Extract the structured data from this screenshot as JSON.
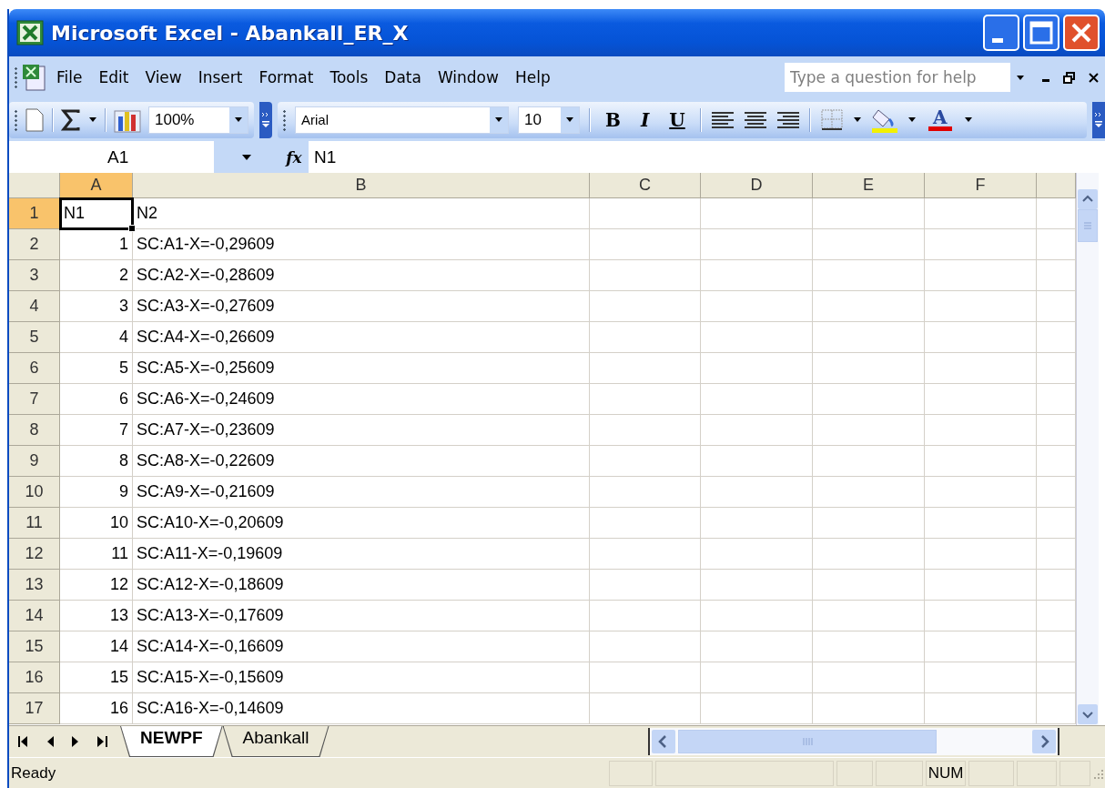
{
  "window": {
    "title": "Microsoft Excel - Abankall_ER_X"
  },
  "menu": [
    {
      "label": "File"
    },
    {
      "label": "Edit"
    },
    {
      "label": "View"
    },
    {
      "label": "Insert"
    },
    {
      "label": "Format"
    },
    {
      "label": "Tools"
    },
    {
      "label": "Data"
    },
    {
      "label": "Window"
    },
    {
      "label": "Help"
    }
  ],
  "help_box": {
    "placeholder": "Type a question for help"
  },
  "toolbar": {
    "zoom": "100%",
    "font": "Arial",
    "font_size": "10",
    "format_buttons": [
      "B",
      "I",
      "U"
    ],
    "font_color_label": "A"
  },
  "formula_bar": {
    "name_box": "A1",
    "function_label": "fx",
    "formula": "N1"
  },
  "grid": {
    "columns": [
      {
        "label": "A",
        "selected": true
      },
      {
        "label": "B",
        "selected": false
      },
      {
        "label": "C",
        "selected": false
      },
      {
        "label": "D",
        "selected": false
      },
      {
        "label": "E",
        "selected": false
      },
      {
        "label": "F",
        "selected": false
      }
    ],
    "rows": [
      {
        "header": "1",
        "selected": true,
        "cells": [
          {
            "text": "N1",
            "kind": "text"
          },
          {
            "text": "N2",
            "kind": "text"
          }
        ]
      },
      {
        "header": "2",
        "selected": false,
        "cells": [
          {
            "text": "1",
            "kind": "number"
          },
          {
            "text": "SC:A1-X=-0,29609",
            "kind": "text"
          }
        ]
      },
      {
        "header": "3",
        "selected": false,
        "cells": [
          {
            "text": "2",
            "kind": "number"
          },
          {
            "text": "SC:A2-X=-0,28609",
            "kind": "text"
          }
        ]
      },
      {
        "header": "4",
        "selected": false,
        "cells": [
          {
            "text": "3",
            "kind": "number"
          },
          {
            "text": "SC:A3-X=-0,27609",
            "kind": "text"
          }
        ]
      },
      {
        "header": "5",
        "selected": false,
        "cells": [
          {
            "text": "4",
            "kind": "number"
          },
          {
            "text": "SC:A4-X=-0,26609",
            "kind": "text"
          }
        ]
      },
      {
        "header": "6",
        "selected": false,
        "cells": [
          {
            "text": "5",
            "kind": "number"
          },
          {
            "text": "SC:A5-X=-0,25609",
            "kind": "text"
          }
        ]
      },
      {
        "header": "7",
        "selected": false,
        "cells": [
          {
            "text": "6",
            "kind": "number"
          },
          {
            "text": "SC:A6-X=-0,24609",
            "kind": "text"
          }
        ]
      },
      {
        "header": "8",
        "selected": false,
        "cells": [
          {
            "text": "7",
            "kind": "number"
          },
          {
            "text": "SC:A7-X=-0,23609",
            "kind": "text"
          }
        ]
      },
      {
        "header": "9",
        "selected": false,
        "cells": [
          {
            "text": "8",
            "kind": "number"
          },
          {
            "text": "SC:A8-X=-0,22609",
            "kind": "text"
          }
        ]
      },
      {
        "header": "10",
        "selected": false,
        "cells": [
          {
            "text": "9",
            "kind": "number"
          },
          {
            "text": "SC:A9-X=-0,21609",
            "kind": "text"
          }
        ]
      },
      {
        "header": "11",
        "selected": false,
        "cells": [
          {
            "text": "10",
            "kind": "number"
          },
          {
            "text": "SC:A10-X=-0,20609",
            "kind": "text"
          }
        ]
      },
      {
        "header": "12",
        "selected": false,
        "cells": [
          {
            "text": "11",
            "kind": "number"
          },
          {
            "text": "SC:A11-X=-0,19609",
            "kind": "text"
          }
        ]
      },
      {
        "header": "13",
        "selected": false,
        "cells": [
          {
            "text": "12",
            "kind": "number"
          },
          {
            "text": "SC:A12-X=-0,18609",
            "kind": "text"
          }
        ]
      },
      {
        "header": "14",
        "selected": false,
        "cells": [
          {
            "text": "13",
            "kind": "number"
          },
          {
            "text": "SC:A13-X=-0,17609",
            "kind": "text"
          }
        ]
      },
      {
        "header": "15",
        "selected": false,
        "cells": [
          {
            "text": "14",
            "kind": "number"
          },
          {
            "text": "SC:A14-X=-0,16609",
            "kind": "text"
          }
        ]
      },
      {
        "header": "16",
        "selected": false,
        "cells": [
          {
            "text": "15",
            "kind": "number"
          },
          {
            "text": "SC:A15-X=-0,15609",
            "kind": "text"
          }
        ]
      },
      {
        "header": "17",
        "selected": false,
        "cells": [
          {
            "text": "16",
            "kind": "number"
          },
          {
            "text": "SC:A16-X=-0,14609",
            "kind": "text"
          }
        ]
      }
    ]
  },
  "sheet_tabs": [
    {
      "label": "NEWPF",
      "selected": true
    },
    {
      "label": "Abankall",
      "selected": false
    }
  ],
  "status_bar": {
    "mode": "Ready",
    "num_lock": "NUM"
  }
}
